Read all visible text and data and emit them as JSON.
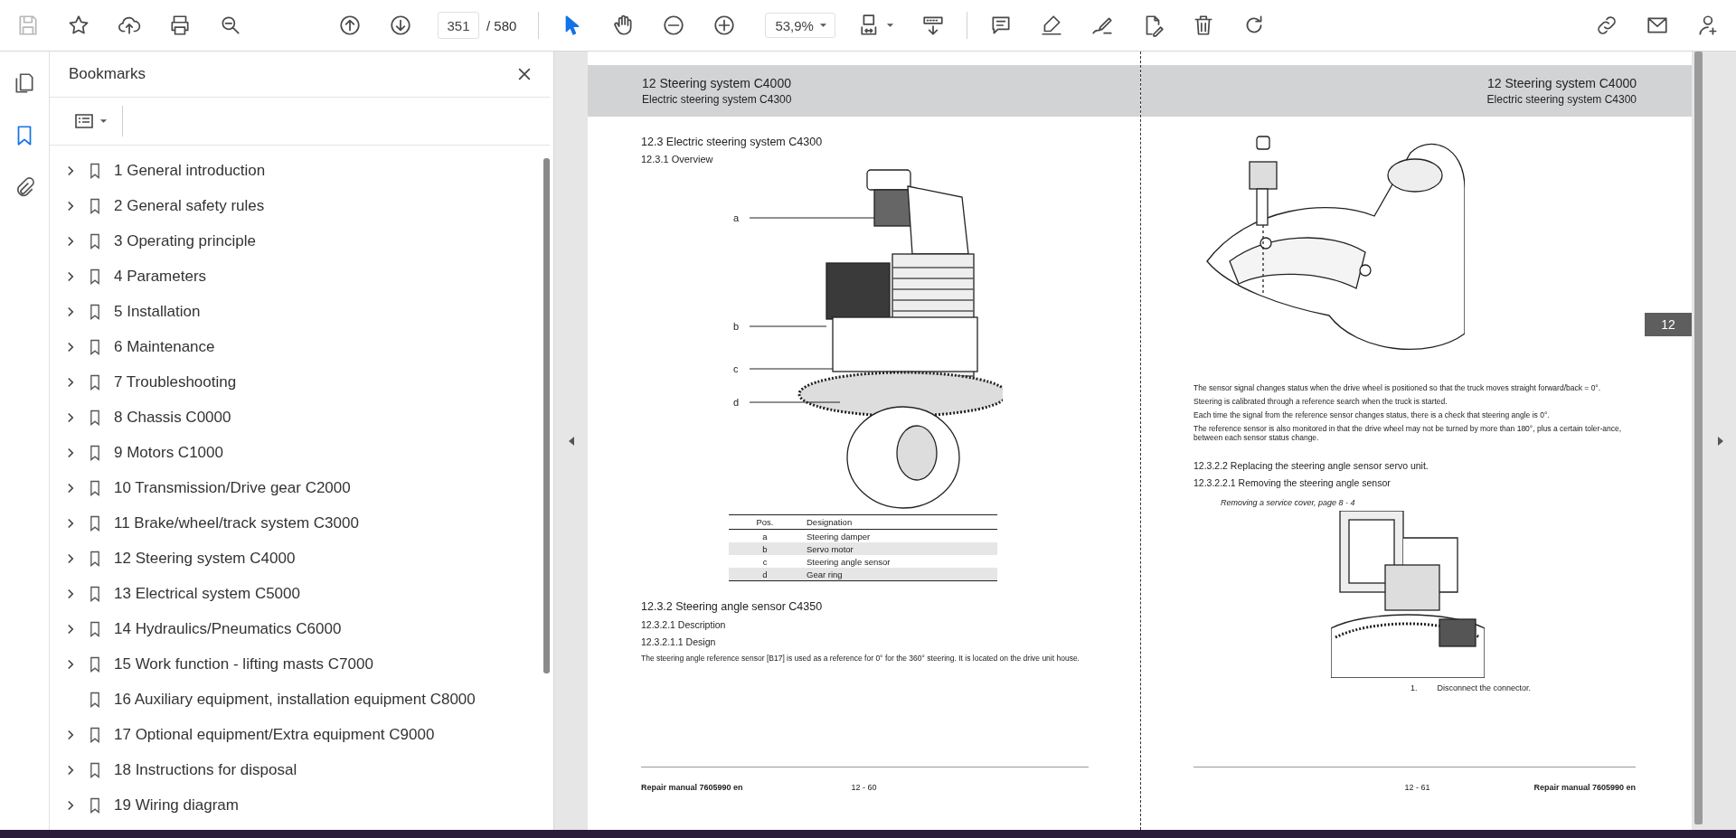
{
  "toolbar": {
    "save": {
      "disabled": true
    },
    "page_field": {
      "value": "351"
    },
    "page_count": "/ 580",
    "pointer_tools": [
      {
        "kind": "select",
        "selected": true
      },
      {
        "kind": "hand",
        "selected": false
      }
    ],
    "zoom_field": {
      "value": "53,9%"
    }
  },
  "rail": [
    {
      "kind": "pages",
      "selected": false
    },
    {
      "kind": "bookmarks",
      "selected": true
    },
    {
      "kind": "attachments",
      "selected": false
    }
  ],
  "bookmarks": {
    "title": "Bookmarks",
    "items": [
      {
        "label": "1 General introduction",
        "expandable": true
      },
      {
        "label": "2 General safety rules",
        "expandable": true
      },
      {
        "label": "3 Operating principle",
        "expandable": true
      },
      {
        "label": "4 Parameters",
        "expandable": true
      },
      {
        "label": "5 Installation",
        "expandable": true
      },
      {
        "label": "6 Maintenance",
        "expandable": true
      },
      {
        "label": "7 Troubleshooting",
        "expandable": true
      },
      {
        "label": "8 Chassis C0000",
        "expandable": true
      },
      {
        "label": "9 Motors C1000",
        "expandable": true
      },
      {
        "label": "10 Transmission/Drive gear C2000",
        "expandable": true
      },
      {
        "label": "11 Brake/wheel/track system C3000",
        "expandable": true
      },
      {
        "label": "12 Steering system C4000",
        "expandable": true
      },
      {
        "label": "13 Electrical system C5000",
        "expandable": true
      },
      {
        "label": "14 Hydraulics/Pneumatics C6000",
        "expandable": true
      },
      {
        "label": "15 Work function - lifting masts C7000",
        "expandable": true
      },
      {
        "label": "16 Auxiliary equipment, installation equipment C8000",
        "expandable": false
      },
      {
        "label": "17 Optional equipment/Extra equipment C9000",
        "expandable": true
      },
      {
        "label": "18 Instructions for disposal",
        "expandable": true
      },
      {
        "label": "19 Wiring diagram",
        "expandable": true
      }
    ]
  },
  "left_page": {
    "header": {
      "title": "12 Steering system C4000",
      "subtitle": "Electric steering system C4300"
    },
    "heading": "12.3 Electric steering system C4300",
    "subheading": "12.3.1 Overview",
    "callouts": [
      "a",
      "b",
      "c",
      "d"
    ],
    "table": {
      "columns": [
        "Pos.",
        "Designation"
      ],
      "rows": [
        [
          "a",
          "Steering damper"
        ],
        [
          "b",
          "Servo motor"
        ],
        [
          "c",
          "Steering angle sensor"
        ],
        [
          "d",
          "Gear ring"
        ]
      ]
    },
    "section": "12.3.2 Steering angle sensor C4350",
    "subsection": "12.3.2.1 Description",
    "subsubsection": "12.3.2.1.1 Design",
    "paragraph": "The steering angle reference sensor [B17] is used as a reference for 0° for the 360° steering. It is located on the drive unit house.",
    "footer": {
      "manual": "Repair manual 7605990 en",
      "page": "12 - 60"
    }
  },
  "right_page": {
    "header": {
      "title": "12 Steering system C4000",
      "subtitle": "Electric steering system C4300"
    },
    "chapter_tab": "12",
    "paragraphs": [
      "The sensor signal changes status when the drive wheel is positioned so that the truck moves straight forward/back = 0°.",
      "Steering is calibrated through a reference search when the truck is started.",
      "Each time the signal from the reference sensor changes status, there is a check that steering angle is 0°.",
      "The reference sensor is also monitored in that the drive wheel may not be turned by more than 180°, plus a certain toler-ance, between each sensor status change."
    ],
    "section": "12.3.2.2 Replacing the steering angle sensor servo unit.",
    "subsection": "12.3.2.2.1 Removing the steering angle sensor",
    "reference": "Removing a service cover, page 8 - 4",
    "steps": [
      {
        "number": "1.",
        "text": "Disconnect the connector."
      }
    ],
    "footer": {
      "page": "12 - 61",
      "manual": "Repair manual 7605990 en"
    }
  }
}
